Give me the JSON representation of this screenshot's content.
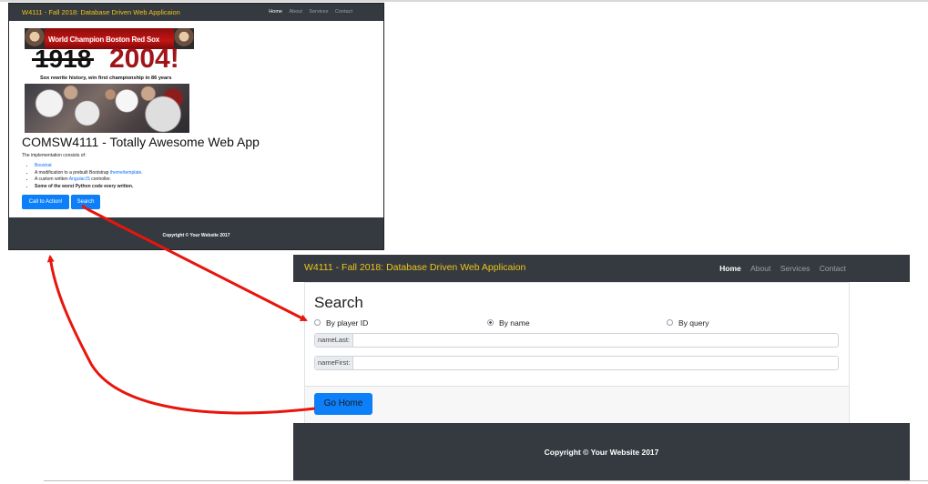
{
  "small": {
    "brand": "W4111 - Fall 2018: Database Driven Web Applicaion",
    "nav": {
      "home": "Home",
      "about": "About",
      "services": "Services",
      "contact": "Contact"
    },
    "banner_text": "World Champion Boston Red Sox",
    "year_old": "1918",
    "year_new": "2004!",
    "tagline": "Sox rewrite history, win first championship in 86 years",
    "heading": "COMSW4111 - Totally Awesome Web App",
    "intro": "The implementation consists of:",
    "list": {
      "item1": "Boostrat",
      "item2_pre": "A modification to a prebuilt Bootstrap ",
      "item2_link": "theme/template",
      "item2_post": ".",
      "item3_pre": "A custom written ",
      "item3_link": "AngularJS",
      "item3_post": " controller.",
      "item4": "Some of the worst Python code every written."
    },
    "cta_label": "Call to Action!",
    "search_label": "Search",
    "footer": "Copyright © Your Website 2017"
  },
  "large": {
    "brand": "W4111 - Fall 2018: Database Driven Web Applicaion",
    "nav": {
      "home": "Home",
      "about": "About",
      "services": "Services",
      "contact": "Contact"
    },
    "title": "Search",
    "radios": {
      "by_id": "By player ID",
      "by_name": "By name",
      "by_query": "By query"
    },
    "selected_radio": "By name",
    "name_last_label": "nameLast:",
    "name_first_label": "nameFirst:",
    "name_last_value": "",
    "name_first_value": "",
    "go_home_label": "Go Home",
    "footer": "Copyright © Your Website 2017"
  },
  "colors": {
    "navbar": "#343a40",
    "brand": "#f0c419",
    "primary": "#0d7ff9",
    "arrow": "#e8150d"
  }
}
